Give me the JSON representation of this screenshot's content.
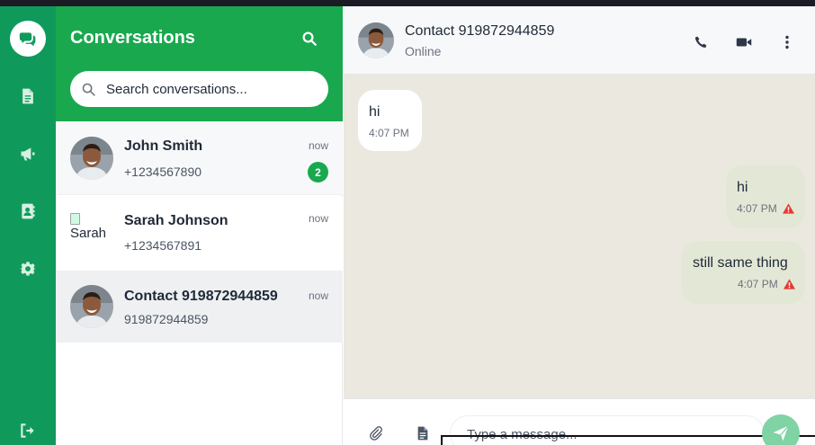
{
  "colors": {
    "rail_green": "#0f9a5c",
    "header_green": "#1aa84f",
    "chat_bg": "#ebe8df",
    "outgoing_bubble": "#e3e8d6",
    "incoming_bubble": "#ffffff",
    "warning_red": "#e53935",
    "send_button": "#7fd3a4"
  },
  "rail": {
    "items": [
      {
        "icon": "chat-bubbles-icon",
        "active": true
      },
      {
        "icon": "document-icon",
        "active": false
      },
      {
        "icon": "megaphone-icon",
        "active": false
      },
      {
        "icon": "contact-book-icon",
        "active": false
      },
      {
        "icon": "gear-icon",
        "active": false
      },
      {
        "icon": "logout-icon",
        "active": false
      }
    ]
  },
  "conversations": {
    "title": "Conversations",
    "search_icon": "search-icon",
    "search_placeholder": "Search conversations...",
    "items": [
      {
        "name": "John Smith",
        "phone": "+1234567890",
        "time": "now",
        "unread": "2",
        "avatar": "photo"
      },
      {
        "name": "Sarah Johnson",
        "phone": "+1234567891",
        "time": "now",
        "unread": "",
        "avatar": "broken",
        "avatar_alt": "Sarah"
      },
      {
        "name": "Contact 919872944859",
        "phone": "919872944859",
        "time": "now",
        "unread": "",
        "avatar": "photo",
        "selected": true
      }
    ]
  },
  "chat": {
    "contact_name": "Contact 919872944859",
    "status": "Online",
    "header_actions": [
      "phone-icon",
      "video-icon",
      "more-vertical-icon"
    ],
    "messages": [
      {
        "direction": "in",
        "text": "hi",
        "time": "4:07 PM",
        "failed": false
      },
      {
        "direction": "out",
        "text": "hi",
        "time": "4:07 PM",
        "failed": true
      },
      {
        "direction": "out",
        "text": "still same thing",
        "time": "4:07 PM",
        "failed": true
      }
    ],
    "composer": {
      "attach_icon": "paperclip-icon",
      "template_icon": "document-icon",
      "placeholder": "Type a message...",
      "send_icon": "send-icon"
    }
  }
}
